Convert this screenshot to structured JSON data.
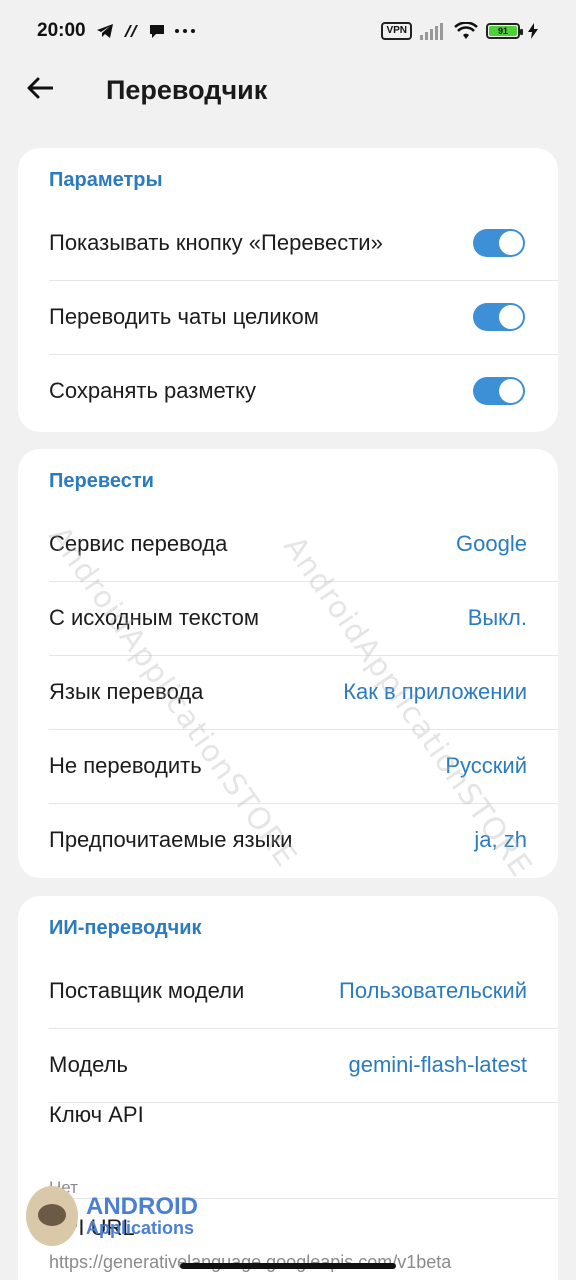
{
  "status_bar": {
    "time": "20:00",
    "vpn": "VPN",
    "battery": "91"
  },
  "header": {
    "title": "Переводчик"
  },
  "sections": {
    "params": {
      "title": "Параметры",
      "rows": [
        {
          "label": "Показывать кнопку «Перевести»",
          "on": true
        },
        {
          "label": "Переводить чаты целиком",
          "on": true
        },
        {
          "label": "Сохранять разметку",
          "on": true
        }
      ]
    },
    "translate": {
      "title": "Перевести",
      "rows": [
        {
          "label": "Сервис перевода",
          "value": "Google"
        },
        {
          "label": "С исходным текстом",
          "value": "Выкл."
        },
        {
          "label": "Язык перевода",
          "value": "Как в приложении"
        },
        {
          "label": "Не переводить",
          "value": "Русский"
        },
        {
          "label": "Предпочитаемые языки",
          "value": "ja, zh"
        }
      ]
    },
    "ai": {
      "title": "ИИ-переводчик",
      "rows": [
        {
          "label": "Поставщик модели",
          "value": "Пользовательский"
        },
        {
          "label": "Модель",
          "value": "gemini-flash-latest"
        }
      ],
      "api_key": {
        "label": "Ключ API",
        "sub": "Нет"
      },
      "api_url": {
        "label": "API URL",
        "sub": "https://generativelanguage.googleapis.com/v1beta"
      }
    }
  },
  "watermark": {
    "text_1": "AndroidApplicationSTORE",
    "text_2": "AndroidApplicationSTORE",
    "logo_line_1": "ANDROID",
    "logo_line_2": "Applications"
  },
  "colors": {
    "accent": "#2a7bbf",
    "toggle_on": "#3d8fd6",
    "background": "#f1f1f1"
  }
}
